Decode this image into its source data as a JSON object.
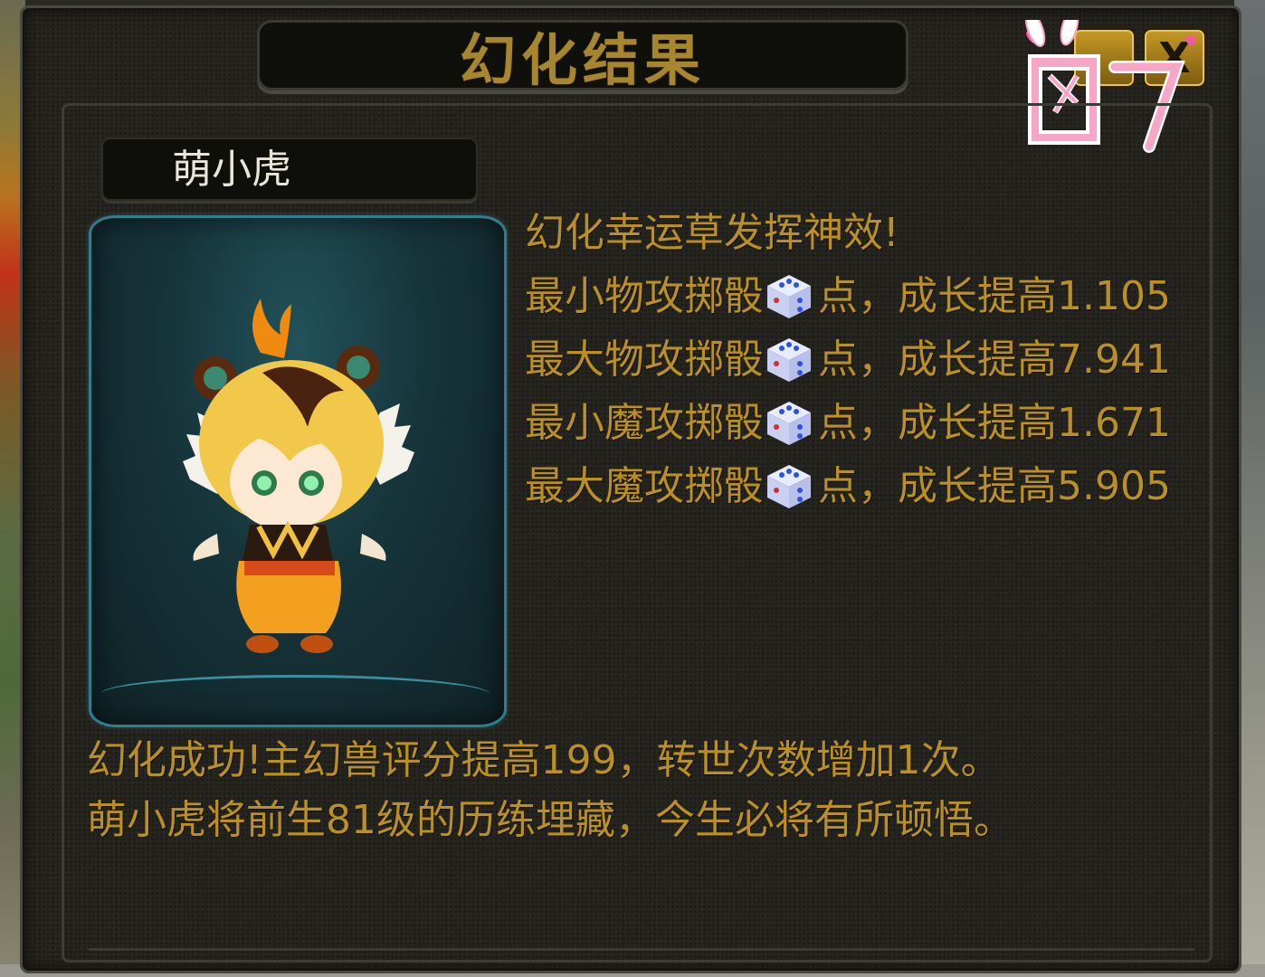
{
  "window": {
    "title": "幻化结果",
    "watermark": "图7",
    "close_label": "X"
  },
  "pet": {
    "name": "萌小虎",
    "icon": "tiger-cub-pet-portrait"
  },
  "results": {
    "headline": "幻化幸运草发挥神效!",
    "stats": [
      {
        "label": "最小物攻掷骰",
        "points_label": "点，成长提高",
        "value": "1.105",
        "icon": "dice-icon"
      },
      {
        "label": "最大物攻掷骰",
        "points_label": "点，成长提高",
        "value": "7.941",
        "icon": "dice-icon"
      },
      {
        "label": "最小魔攻掷骰",
        "points_label": "点，成长提高",
        "value": "1.671",
        "icon": "dice-icon"
      },
      {
        "label": "最大魔攻掷骰",
        "points_label": "点，成长提高",
        "value": "5.905",
        "icon": "dice-icon"
      }
    ]
  },
  "messages": {
    "line1": "幻化成功!主幻兽评分提高199，转世次数增加1次。",
    "line2": "萌小虎将前生81级的历练埋藏，今生必将有所顿悟。"
  },
  "colors": {
    "gold_text": "#b89025",
    "panel_bg": "#26241f",
    "preview_border": "#2f7d8f",
    "watermark_pink": "#f7a6c8"
  }
}
